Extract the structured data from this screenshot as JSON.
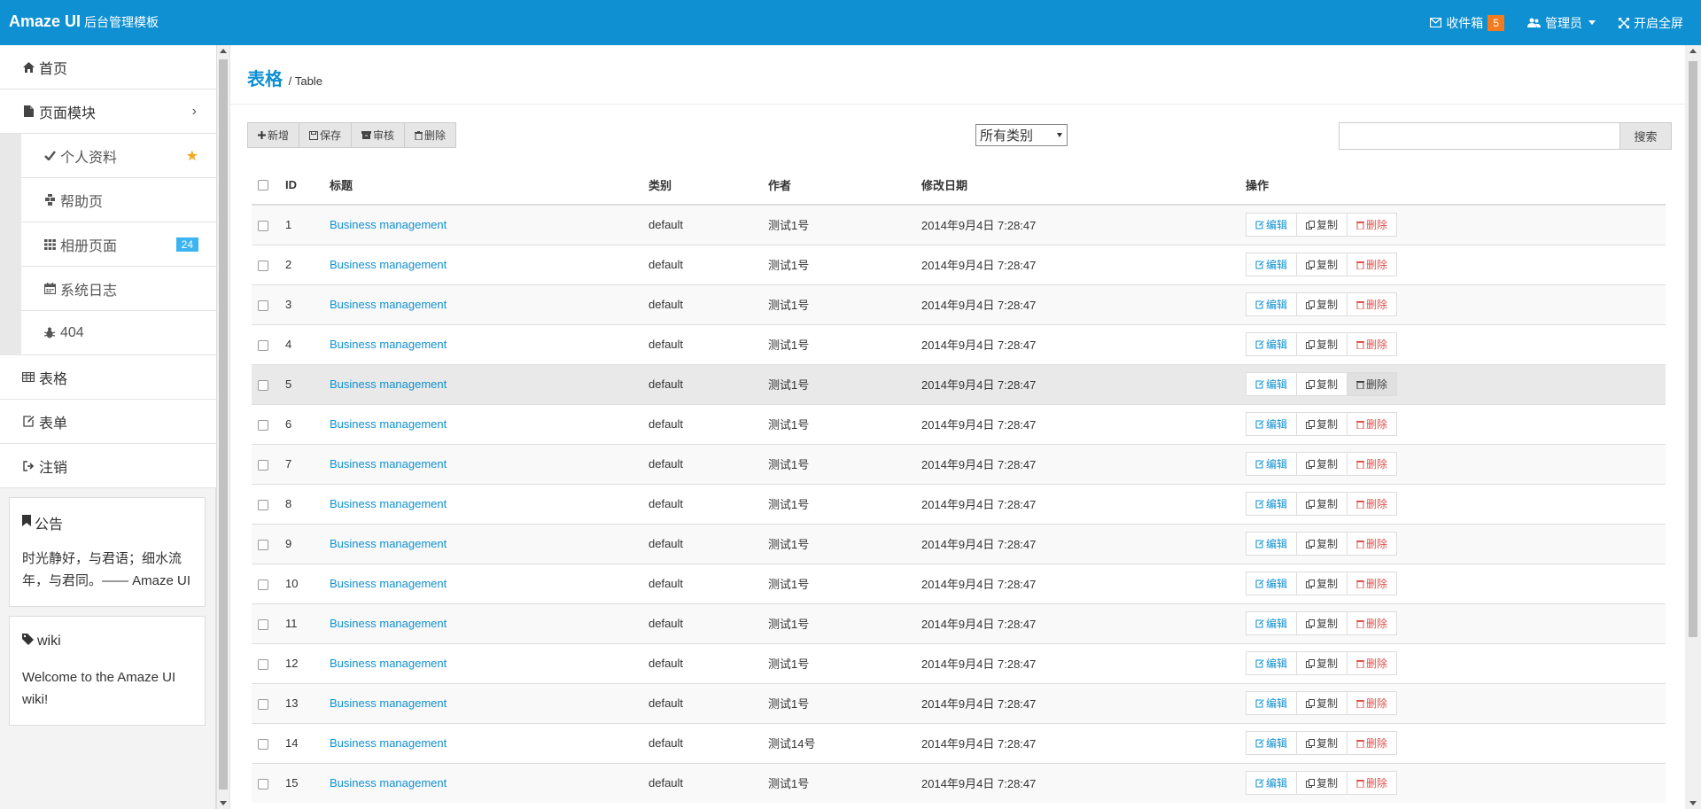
{
  "header": {
    "brand": "Amaze UI",
    "brand_sub": "后台管理模板",
    "inbox_label": "收件箱",
    "inbox_count": "5",
    "admin_label": "管理员",
    "fullscreen_label": "开启全屏"
  },
  "sidebar": {
    "items": [
      {
        "label": "首页",
        "icon": "home-icon"
      },
      {
        "label": "页面模块",
        "icon": "file-icon"
      }
    ],
    "sub_items": [
      {
        "label": "个人资料",
        "icon": "check-icon"
      },
      {
        "label": "帮助页",
        "icon": "puzzle-icon"
      },
      {
        "label": "相册页面",
        "icon": "grid-icon",
        "count": "24"
      },
      {
        "label": "系统日志",
        "icon": "calendar-icon"
      },
      {
        "label": "404",
        "icon": "bug-icon"
      }
    ],
    "bottom_items": [
      {
        "label": "表格",
        "icon": "table-icon"
      },
      {
        "label": "表单",
        "icon": "edit-icon"
      },
      {
        "label": "注销",
        "icon": "sign-out-icon"
      }
    ],
    "notice": {
      "title": "公告",
      "body": "时光静好，与君语；细水流年，与君同。—— Amaze UI"
    },
    "wiki": {
      "title": "wiki",
      "body": "Welcome to the Amaze UI wiki!"
    }
  },
  "main": {
    "title": "表格",
    "subtitle": "Table",
    "toolbar": {
      "add": "新增",
      "save": "保存",
      "review": "审核",
      "delete": "删除"
    },
    "category_select": "所有类别",
    "search": {
      "value": "",
      "button": "搜索"
    },
    "table": {
      "headers": [
        "ID",
        "标题",
        "类别",
        "作者",
        "修改日期",
        "操作"
      ],
      "ops": {
        "edit": "编辑",
        "copy": "复制",
        "delete": "删除"
      },
      "rows": [
        {
          "id": "1",
          "title": "Business management",
          "category": "default",
          "author": "测试1号",
          "date": "2014年9月4日 7:28:47"
        },
        {
          "id": "2",
          "title": "Business management",
          "category": "default",
          "author": "测试1号",
          "date": "2014年9月4日 7:28:47"
        },
        {
          "id": "3",
          "title": "Business management",
          "category": "default",
          "author": "测试1号",
          "date": "2014年9月4日 7:28:47"
        },
        {
          "id": "4",
          "title": "Business management",
          "category": "default",
          "author": "测试1号",
          "date": "2014年9月4日 7:28:47"
        },
        {
          "id": "5",
          "title": "Business management",
          "category": "default",
          "author": "测试1号",
          "date": "2014年9月4日 7:28:47"
        },
        {
          "id": "6",
          "title": "Business management",
          "category": "default",
          "author": "测试1号",
          "date": "2014年9月4日 7:28:47"
        },
        {
          "id": "7",
          "title": "Business management",
          "category": "default",
          "author": "测试1号",
          "date": "2014年9月4日 7:28:47"
        },
        {
          "id": "8",
          "title": "Business management",
          "category": "default",
          "author": "测试1号",
          "date": "2014年9月4日 7:28:47"
        },
        {
          "id": "9",
          "title": "Business management",
          "category": "default",
          "author": "测试1号",
          "date": "2014年9月4日 7:28:47"
        },
        {
          "id": "10",
          "title": "Business management",
          "category": "default",
          "author": "测试1号",
          "date": "2014年9月4日 7:28:47"
        },
        {
          "id": "11",
          "title": "Business management",
          "category": "default",
          "author": "测试1号",
          "date": "2014年9月4日 7:28:47"
        },
        {
          "id": "12",
          "title": "Business management",
          "category": "default",
          "author": "测试1号",
          "date": "2014年9月4日 7:28:47"
        },
        {
          "id": "13",
          "title": "Business management",
          "category": "default",
          "author": "测试1号",
          "date": "2014年9月4日 7:28:47"
        },
        {
          "id": "14",
          "title": "Business management",
          "category": "default",
          "author": "测试14号",
          "date": "2014年9月4日 7:28:47"
        },
        {
          "id": "15",
          "title": "Business management",
          "category": "default",
          "author": "测试1号",
          "date": "2014年9月4日 7:28:47"
        }
      ]
    }
  },
  "colors": {
    "primary": "#0e90d2",
    "warning": "#f37b1d",
    "danger": "#dd514c",
    "secondary": "#3bb4f2",
    "star": "#f3a81d"
  }
}
